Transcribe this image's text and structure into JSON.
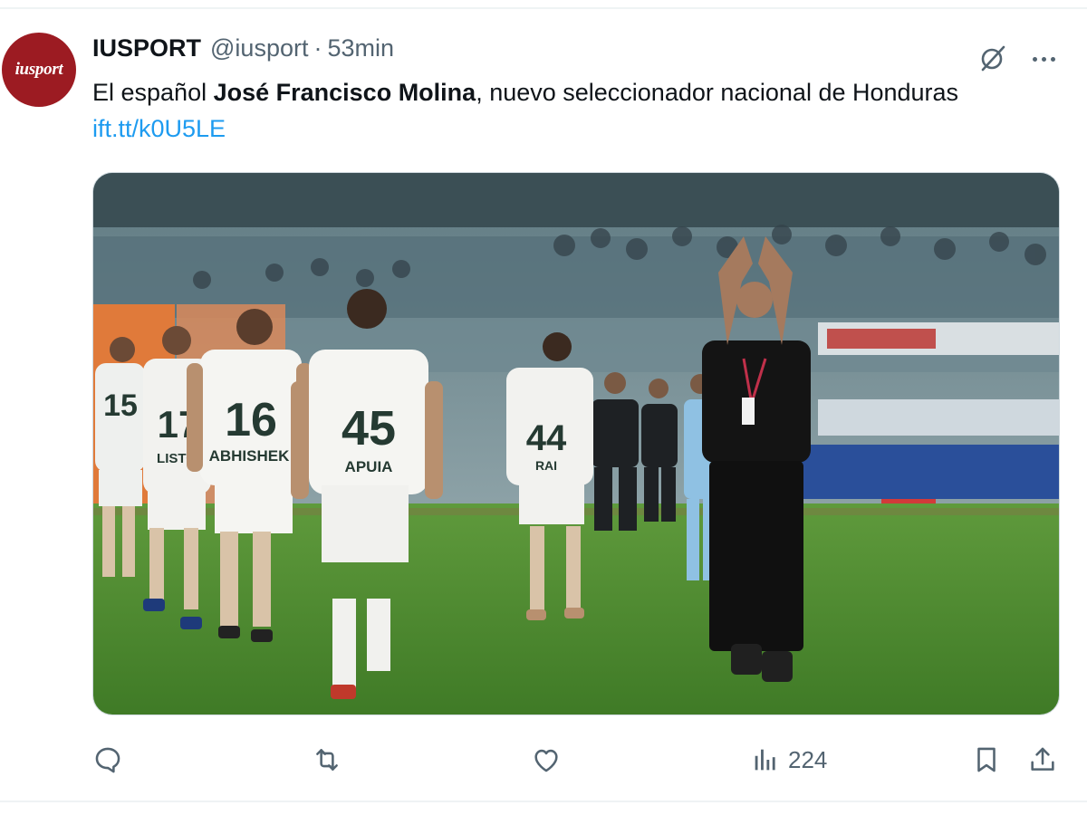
{
  "tweet": {
    "avatar_text": "iusport",
    "display_name": "IUSPORT",
    "handle": "@iusport",
    "separator": "·",
    "time": "53min",
    "text_intro": "El español ",
    "text_bold": "José Francisco Molina",
    "text_rest": ", nuevo seleccionador nacional de Honduras ",
    "link_text": "ift.tt/k0U5LE",
    "media": {
      "jersey_numbers": [
        "15",
        "17",
        "16",
        "45",
        "44"
      ],
      "jersey_names": [
        "LISTO",
        "ABHISHEK",
        "APUIA",
        "RAI"
      ]
    }
  },
  "actions": {
    "views": "224"
  },
  "icons": {
    "reply": "reply-icon",
    "retweet": "retweet-icon",
    "like": "heart-icon",
    "views": "views-chart-icon",
    "bookmark": "bookmark-icon",
    "share": "share-icon",
    "grok": "grok-icon",
    "more": "more-icon"
  },
  "colors": {
    "link": "#1d9bf0",
    "secondary_text": "#536471",
    "avatar_bg": "#9c1b22"
  }
}
